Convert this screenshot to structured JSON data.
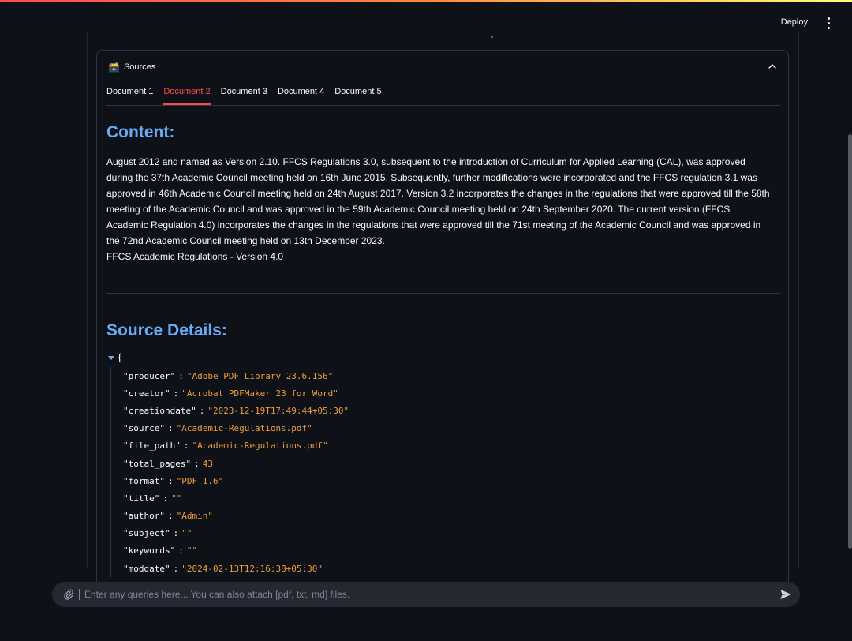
{
  "header": {
    "deploy_label": "Deploy",
    "menu_icon": "kebab-menu-icon"
  },
  "expander": {
    "icon": "🗃️",
    "title": "Sources",
    "tabs": [
      "Document 1",
      "Document 2",
      "Document 3",
      "Document 4",
      "Document 5"
    ],
    "active_tab": "Document 2"
  },
  "content": {
    "heading": "Content:",
    "paragraph": "August 2012 and named as Version 2.10. FFCS Regulations 3.0, subsequent to the introduction of Curriculum for Applied Learning (CAL), was approved during the 37th Academic Council meeting held on 16th June 2015. Subsequently, further modifications were incorporated and the FFCS regulation 3.1 was approved in 46th Academic Council meeting held on 24th August 2017. Version 3.2 incorporates the changes in the regulations that were approved till the 58th meeting of the Academic Council and was approved in the 59th Academic Council meeting held on 24th September 2020. The current version (FFCS Academic Regulation 4.0) incorporates the changes in the regulations that were approved till the 71st meeting of the Academic Council and was approved in the 72nd Academic Council meeting held on 13th December 2023.",
    "footer_line": "FFCS Academic Regulations - Version 4.0"
  },
  "source_details": {
    "heading": "Source Details:",
    "open_brace": "{",
    "entries": [
      {
        "key": "\"producer\"",
        "value": "\"Adobe PDF Library 23.6.156\""
      },
      {
        "key": "\"creator\"",
        "value": "\"Acrobat PDFMaker 23 for Word\""
      },
      {
        "key": "\"creationdate\"",
        "value": "\"2023-12-19T17:49:44+05:30\""
      },
      {
        "key": "\"source\"",
        "value": "\"Academic-Regulations.pdf\""
      },
      {
        "key": "\"file_path\"",
        "value": "\"Academic-Regulations.pdf\""
      },
      {
        "key": "\"total_pages\"",
        "value": "43"
      },
      {
        "key": "\"format\"",
        "value": "\"PDF 1.6\""
      },
      {
        "key": "\"title\"",
        "value": "\"\""
      },
      {
        "key": "\"author\"",
        "value": "\"Admin\""
      },
      {
        "key": "\"subject\"",
        "value": "\"\""
      },
      {
        "key": "\"keywords\"",
        "value": "\"\""
      },
      {
        "key": "\"moddate\"",
        "value": "\"2024-02-13T12:16:38+05:30\""
      }
    ]
  },
  "chat": {
    "placeholder": "Enter any queries here... You can also attach [pdf, txt, md] files.",
    "attach_icon": "paperclip-icon",
    "send_icon": "send-icon"
  },
  "colors": {
    "accent": "#ff4b4b",
    "heading": "#6aabf5",
    "json_value": "#ef9d3b",
    "background": "#0e1117"
  }
}
